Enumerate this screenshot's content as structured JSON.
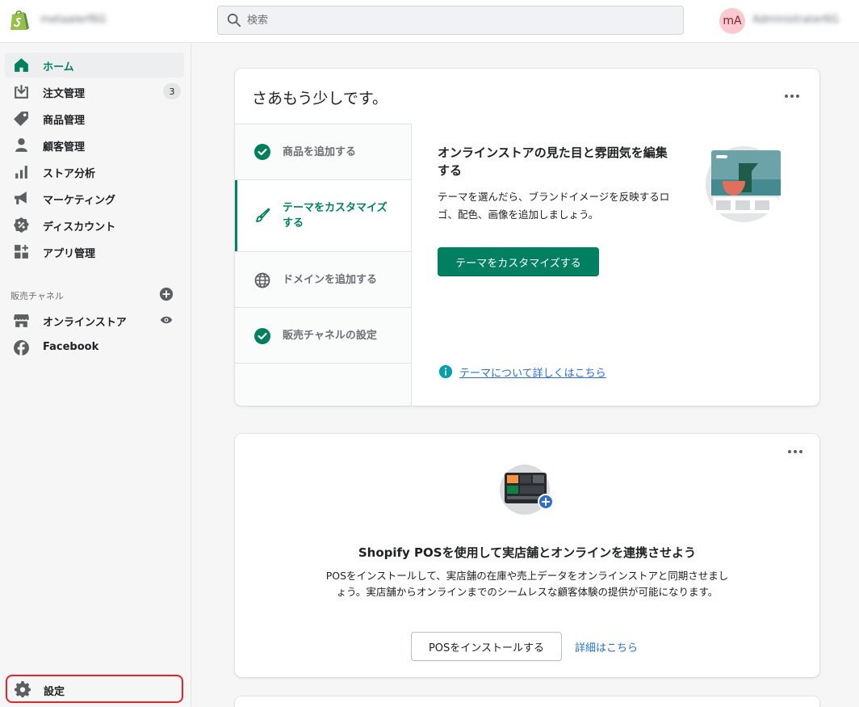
{
  "topbar": {
    "store_name": "metaalerf6G",
    "search_placeholder": "検索",
    "avatar_initials": "mA",
    "user_name": "Administrater6G"
  },
  "sidebar": {
    "items": [
      {
        "label": "ホーム",
        "icon": "home-icon",
        "active": true
      },
      {
        "label": "注文管理",
        "icon": "orders-icon",
        "badge": "3"
      },
      {
        "label": "商品管理",
        "icon": "tag-icon"
      },
      {
        "label": "顧客管理",
        "icon": "person-icon"
      },
      {
        "label": "ストア分析",
        "icon": "bar-chart-icon"
      },
      {
        "label": "マーケティング",
        "icon": "megaphone-icon"
      },
      {
        "label": "ディスカウント",
        "icon": "discount-icon"
      },
      {
        "label": "アプリ管理",
        "icon": "apps-icon"
      }
    ],
    "channels_label": "販売チャネル",
    "channels": [
      {
        "label": "オンラインストア",
        "icon": "store-icon"
      },
      {
        "label": "Facebook",
        "icon": "facebook-icon"
      }
    ],
    "settings_label": "設定"
  },
  "setup_card": {
    "title": "さあもう少しです。",
    "steps": [
      {
        "label": "商品を追加する",
        "state": "done"
      },
      {
        "label": "テーマをカスタマイズする",
        "state": "active"
      },
      {
        "label": "ドメインを追加する",
        "state": "todo"
      },
      {
        "label": "販売チャネルの設定",
        "state": "done"
      }
    ],
    "panel_title": "オンラインストアの見た目と雰囲気を編集する",
    "panel_text": "テーマを選んだら、ブランドイメージを反映するロゴ、配色、画像を追加しましょう。",
    "primary_button": "テーマをカスタマイズする",
    "help_link": "テーマについて詳しくはこちら"
  },
  "pos_card": {
    "title": "Shopify POSを使用して実店舗とオンラインを連携させよう",
    "text": "POSをインストールして、実店舗の在庫や売上データをオンラインストアと同期させましょう。実店舗からオンラインまでのシームレスな顧客体験の提供が可能になります。",
    "install_button": "POSをインストールする",
    "details_link": "詳細はこちら"
  },
  "colors": {
    "brand_green": "#008060",
    "shopify_logo_green": "#95bf47",
    "link_blue": "#2c6ecb",
    "settings_highlight": "#e5232c"
  }
}
